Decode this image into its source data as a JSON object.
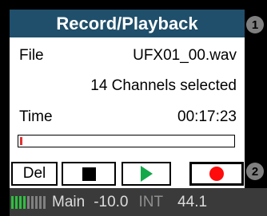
{
  "title": "Record/Playback",
  "badges": {
    "top": "1",
    "bottom": "2"
  },
  "file": {
    "label": "File",
    "name": "UFX01_00.wav"
  },
  "channels_text": "14 Channels selected",
  "time": {
    "label": "Time",
    "value": "00:17:23"
  },
  "progress": {
    "fraction": 0.01,
    "color": "#e53030"
  },
  "controls": {
    "delete_label": "Del",
    "stop_icon": "stop-icon",
    "play_icon": "play-icon",
    "record_icon": "record-icon"
  },
  "status": {
    "meter_active": 4,
    "meter_total": 9,
    "meter_colors": {
      "active": "#2fbf3f",
      "inactive": "#808080"
    },
    "main_label": "Main",
    "level": "-10.0",
    "clock": "INT",
    "rate": "44.1"
  },
  "colors": {
    "title_bg": "#1f4f6b",
    "play": "#13a84a",
    "record": "#ff0b0b",
    "status_bg": "#3a3a3a"
  }
}
